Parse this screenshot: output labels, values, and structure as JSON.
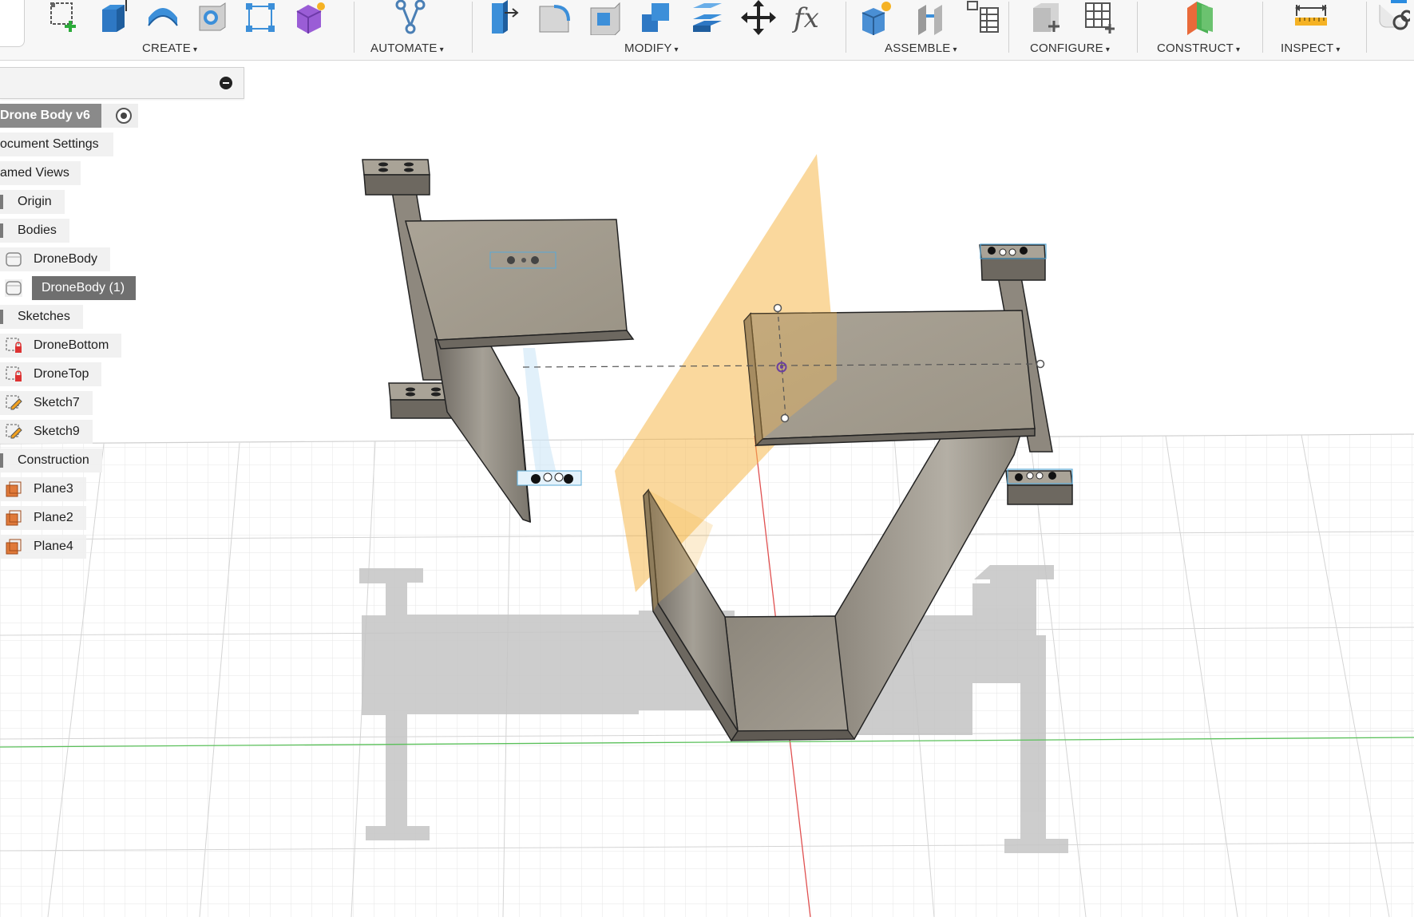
{
  "toolbar": {
    "groups": [
      {
        "label": "CREATE",
        "icons": [
          "new-sketch-icon",
          "extrude-icon",
          "revolve-icon",
          "hole-icon",
          "pattern-icon",
          "create-form-icon"
        ]
      },
      {
        "label": "AUTOMATE",
        "icons": [
          "automate-icon"
        ]
      },
      {
        "label": "MODIFY",
        "icons": [
          "press-pull-icon",
          "fillet-icon",
          "shell-icon",
          "combine-icon",
          "offset-face-icon",
          "move-icon",
          "parameters-fx-icon"
        ]
      },
      {
        "label": "ASSEMBLE",
        "icons": [
          "new-component-icon",
          "joint-icon",
          "bom-table-icon"
        ]
      },
      {
        "label": "CONFIGURE",
        "icons": [
          "configure-icon",
          "configure-table-icon"
        ]
      },
      {
        "label": "CONSTRUCT",
        "icons": [
          "construct-plane-icon"
        ]
      },
      {
        "label": "INSPECT",
        "icons": [
          "measure-icon"
        ]
      }
    ],
    "caret": "▾"
  },
  "browser": {
    "nodes": [
      {
        "label": "Drone Body v6",
        "type": "root"
      },
      {
        "label": "ocument Settings",
        "type": "folder"
      },
      {
        "label": "amed Views",
        "type": "folder"
      },
      {
        "label": "Origin",
        "type": "folder"
      },
      {
        "label": "Bodies",
        "type": "folder"
      },
      {
        "label": "DroneBody",
        "type": "body"
      },
      {
        "label": "DroneBody (1)",
        "type": "body",
        "selected": true
      },
      {
        "label": "Sketches",
        "type": "folder"
      },
      {
        "label": "DroneBottom",
        "type": "sketch-locked"
      },
      {
        "label": "DroneTop",
        "type": "sketch-locked"
      },
      {
        "label": "Sketch7",
        "type": "sketch"
      },
      {
        "label": "Sketch9",
        "type": "sketch"
      },
      {
        "label": "Construction",
        "type": "folder"
      },
      {
        "label": "Plane3",
        "type": "plane"
      },
      {
        "label": "Plane2",
        "type": "plane"
      },
      {
        "label": "Plane4",
        "type": "plane"
      }
    ]
  },
  "colors": {
    "toolbar_bg": "#f7f7f7",
    "body_face": "#a59d8f",
    "body_side": "#7c766c",
    "construction_plane": "#f5b84c",
    "selection": "#5aa9d6",
    "grid_line": "#e3e3e3",
    "y_axis": "#e05050",
    "x_axis": "#5ac05a"
  }
}
